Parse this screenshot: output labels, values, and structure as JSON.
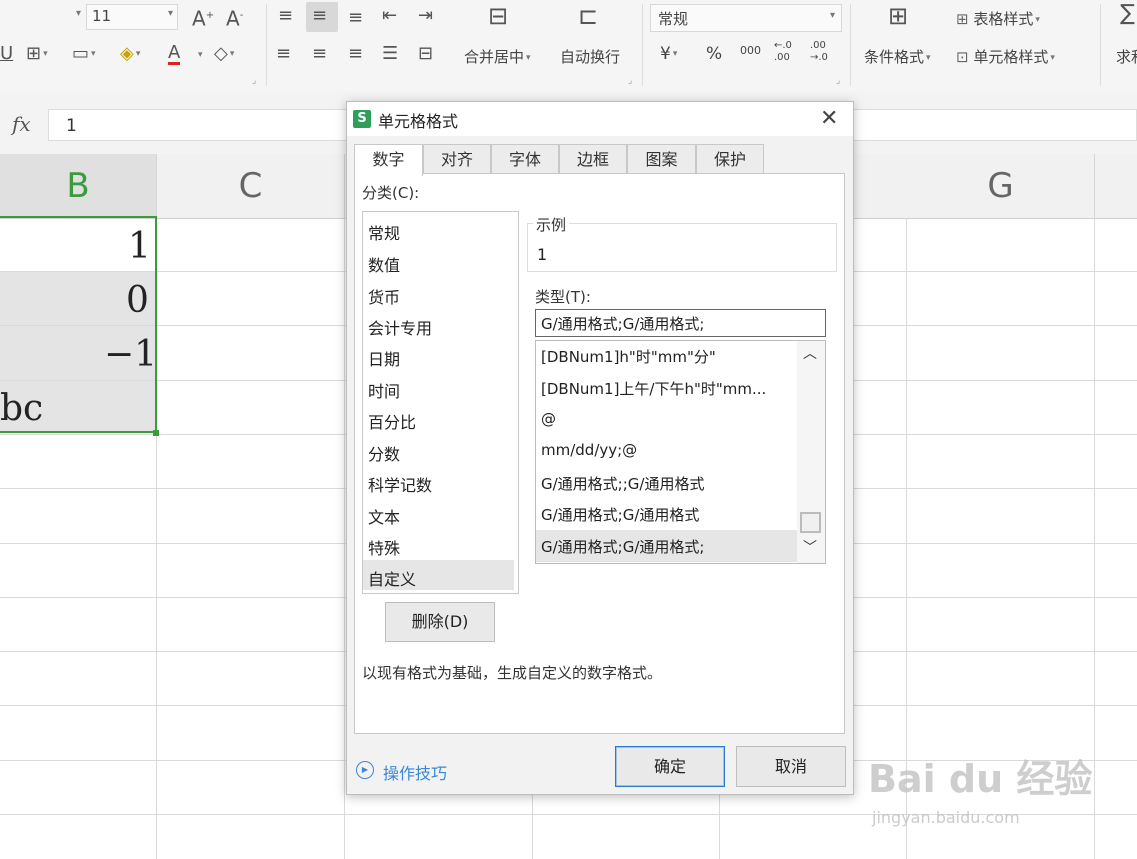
{
  "ribbon": {
    "font_size": "11",
    "font_grow_icon": "A⁺",
    "font_shrink_icon": "A⁻",
    "merge_center_label": "合并居中",
    "wrap_text_label": "自动换行",
    "number_format_value": "常规",
    "currency_symbol": "¥",
    "percent_symbol": "%",
    "thousands_symbol": "000",
    "increase_decimal": "←.0 .00",
    "decrease_decimal": ".00 →.0",
    "conditional_format_label": "条件格式",
    "table_style_label": "表格样式",
    "cell_style_label": "单元格样式",
    "sum_label": "求和"
  },
  "formula_bar": {
    "fx_label": "fx",
    "value": "1"
  },
  "sheet": {
    "columns": [
      "B",
      "C",
      "G"
    ],
    "cells_b": [
      "1",
      "0",
      "−1",
      "bc"
    ]
  },
  "dialog": {
    "title": "单元格格式",
    "app_icon_letter": "S",
    "tabs": [
      "数字",
      "对齐",
      "字体",
      "边框",
      "图案",
      "保护"
    ],
    "category_label": "分类(C):",
    "categories": [
      "常规",
      "数值",
      "货币",
      "会计专用",
      "日期",
      "时间",
      "百分比",
      "分数",
      "科学记数",
      "文本",
      "特殊",
      "自定义"
    ],
    "sample_label": "示例",
    "sample_value": "1",
    "type_label": "类型(T):",
    "type_input_value": "G/通用格式;G/通用格式;",
    "type_items": [
      "[DBNum1]h\"时\"mm\"分\"",
      "[DBNum1]上午/下午h\"时\"mm...",
      "@",
      "mm/dd/yy;@",
      "G/通用格式;;G/通用格式",
      "G/通用格式;G/通用格式",
      "G/通用格式;G/通用格式;"
    ],
    "delete_button": "删除(D)",
    "description": "以现有格式为基础，生成自定义的数字格式。",
    "tips_link": "操作技巧",
    "ok_button": "确定",
    "cancel_button": "取消"
  },
  "watermark": {
    "brand": "Bai  du 经验",
    "url": "jingyan.baidu.com"
  }
}
